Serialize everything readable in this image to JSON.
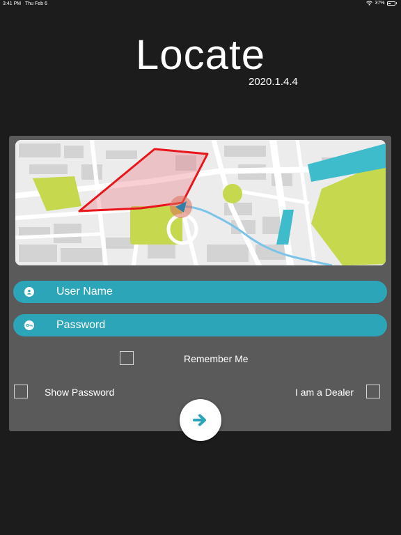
{
  "status_bar": {
    "time": "3:41 PM",
    "date": "Thu Feb 6",
    "battery_text": "37%",
    "battery_level": 0.37
  },
  "app": {
    "title": "Locate",
    "version": "2020.1.4.4"
  },
  "login": {
    "username_placeholder": "User Name",
    "password_placeholder": "Password",
    "remember_label": "Remember Me",
    "show_password_label": "Show Password",
    "dealer_label": "I am a Dealer"
  },
  "icons": {
    "wifi": "wifi-icon",
    "battery": "battery-icon",
    "user": "user-icon",
    "key": "key-icon",
    "arrow": "arrow-right-icon"
  },
  "colors": {
    "background": "#1c1c1c",
    "card": "#5a5a5a",
    "accent": "#2ba5b7",
    "geofence": "#e8151b",
    "route": "#7cc3e8",
    "park": "#c5d84e",
    "water": "#3fbccb"
  }
}
